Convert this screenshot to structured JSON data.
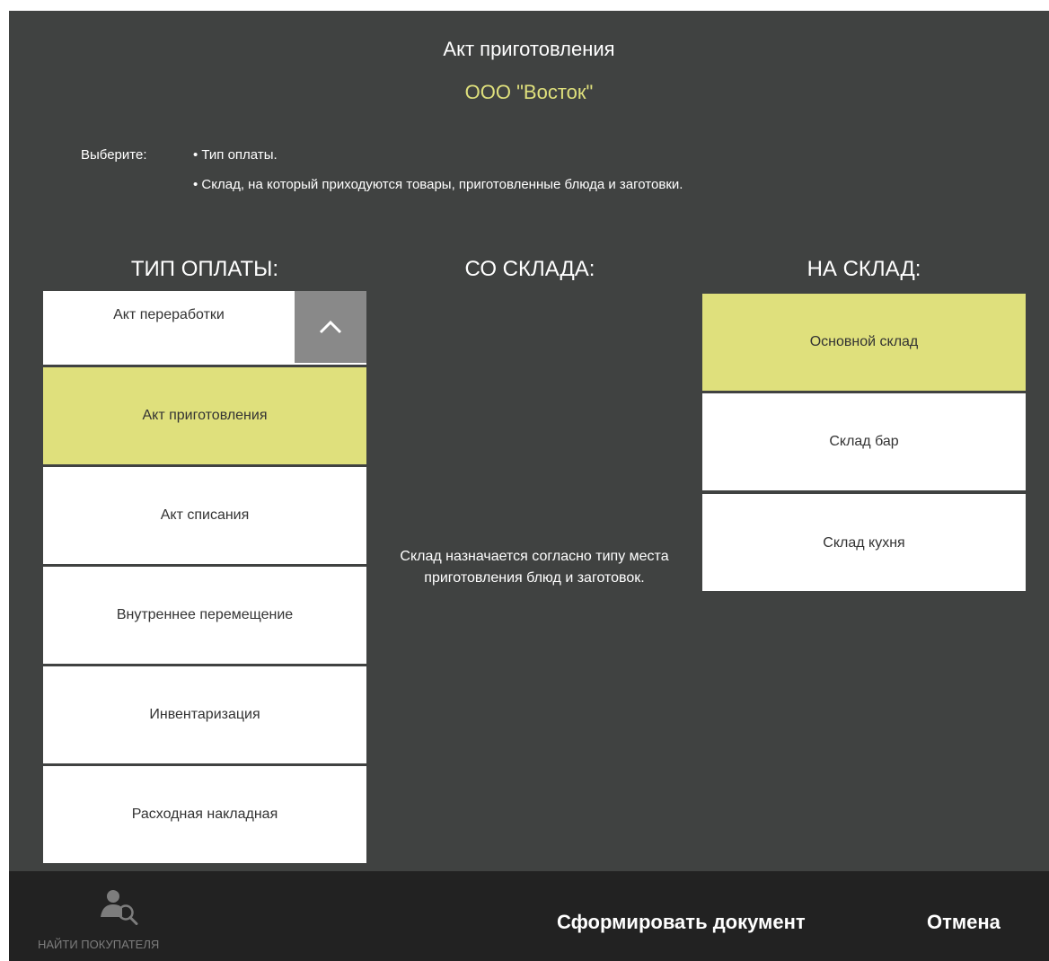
{
  "header": {
    "title": "Акт приготовления",
    "org": "ООО \"Восток\""
  },
  "instructions": {
    "label": "Выберите:",
    "items": [
      "• Тип оплаты.",
      "• Склад, на который приходуются товары, приготовленные блюда и заготовки."
    ]
  },
  "columns": {
    "payment_type": "ТИП ОПЛАТЫ:",
    "from_warehouse": "СО СКЛАДА:",
    "to_warehouse": "НА СКЛАД:"
  },
  "payment_types": [
    {
      "label": "Акт переработки",
      "selected": false
    },
    {
      "label": "Акт приготовления",
      "selected": true
    },
    {
      "label": "Акт списания",
      "selected": false
    },
    {
      "label": "Внутреннее перемещение",
      "selected": false
    },
    {
      "label": "Инвентаризация",
      "selected": false
    },
    {
      "label": "Расходная накладная",
      "selected": false
    }
  ],
  "from_note": "Склад назначается согласно типу места приготовления блюд и заготовок.",
  "warehouses": [
    {
      "label": "Основной склад",
      "selected": true
    },
    {
      "label": "Склад бар",
      "selected": false
    },
    {
      "label": "Склад кухня",
      "selected": false
    }
  ],
  "footer": {
    "find_customer": "НАЙТИ ПОКУПАТЕЛЯ",
    "create_doc": "Сформировать документ",
    "cancel": "Отмена"
  },
  "colors": {
    "panel_bg": "#404241",
    "accent": "#dfe07c",
    "footer_bg": "#222222",
    "scroll_button": "#898989"
  },
  "icons": {
    "scroll_up": "chevron-up-icon",
    "find_customer": "user-search-icon"
  }
}
